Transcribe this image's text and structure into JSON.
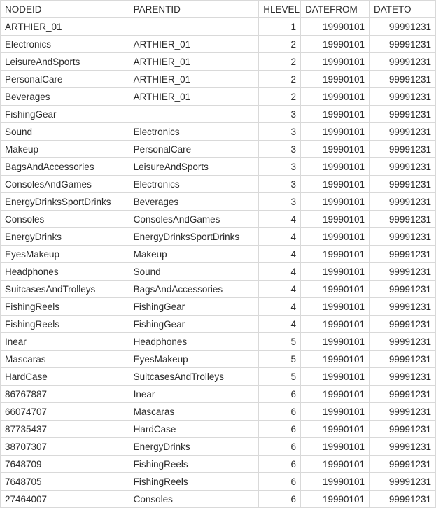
{
  "table": {
    "headers": {
      "nodeid": "NODEID",
      "parentid": "PARENTID",
      "hlevel": "HLEVEL",
      "datefrom": "DATEFROM",
      "dateto": "DATETO"
    },
    "rows": [
      {
        "nodeid": "ARTHIER_01",
        "parentid": "",
        "hlevel": "1",
        "datefrom": "19990101",
        "dateto": "99991231"
      },
      {
        "nodeid": "Electronics",
        "parentid": "ARTHIER_01",
        "hlevel": "2",
        "datefrom": "19990101",
        "dateto": "99991231"
      },
      {
        "nodeid": "LeisureAndSports",
        "parentid": "ARTHIER_01",
        "hlevel": "2",
        "datefrom": "19990101",
        "dateto": "99991231"
      },
      {
        "nodeid": "PersonalCare",
        "parentid": "ARTHIER_01",
        "hlevel": "2",
        "datefrom": "19990101",
        "dateto": "99991231"
      },
      {
        "nodeid": "Beverages",
        "parentid": "ARTHIER_01",
        "hlevel": "2",
        "datefrom": "19990101",
        "dateto": "99991231"
      },
      {
        "nodeid": "FishingGear",
        "parentid": "",
        "hlevel": "3",
        "datefrom": "19990101",
        "dateto": "99991231"
      },
      {
        "nodeid": "Sound",
        "parentid": "Electronics",
        "hlevel": "3",
        "datefrom": "19990101",
        "dateto": "99991231"
      },
      {
        "nodeid": "Makeup",
        "parentid": "PersonalCare",
        "hlevel": "3",
        "datefrom": "19990101",
        "dateto": "99991231"
      },
      {
        "nodeid": "BagsAndAccessories",
        "parentid": "LeisureAndSports",
        "hlevel": "3",
        "datefrom": "19990101",
        "dateto": "99991231"
      },
      {
        "nodeid": "ConsolesAndGames",
        "parentid": "Electronics",
        "hlevel": "3",
        "datefrom": "19990101",
        "dateto": "99991231"
      },
      {
        "nodeid": "EnergyDrinksSportDrinks",
        "parentid": "Beverages",
        "hlevel": "3",
        "datefrom": "19990101",
        "dateto": "99991231"
      },
      {
        "nodeid": "Consoles",
        "parentid": "ConsolesAndGames",
        "hlevel": "4",
        "datefrom": "19990101",
        "dateto": "99991231"
      },
      {
        "nodeid": "EnergyDrinks",
        "parentid": "EnergyDrinksSportDrinks",
        "hlevel": "4",
        "datefrom": "19990101",
        "dateto": "99991231"
      },
      {
        "nodeid": "EyesMakeup",
        "parentid": "Makeup",
        "hlevel": "4",
        "datefrom": "19990101",
        "dateto": "99991231"
      },
      {
        "nodeid": "Headphones",
        "parentid": "Sound",
        "hlevel": "4",
        "datefrom": "19990101",
        "dateto": "99991231"
      },
      {
        "nodeid": "SuitcasesAndTrolleys",
        "parentid": "BagsAndAccessories",
        "hlevel": "4",
        "datefrom": "19990101",
        "dateto": "99991231"
      },
      {
        "nodeid": "FishingReels",
        "parentid": "FishingGear",
        "hlevel": "4",
        "datefrom": "19990101",
        "dateto": "99991231"
      },
      {
        "nodeid": "FishingReels",
        "parentid": "FishingGear",
        "hlevel": "4",
        "datefrom": "19990101",
        "dateto": "99991231"
      },
      {
        "nodeid": "Inear",
        "parentid": "Headphones",
        "hlevel": "5",
        "datefrom": "19990101",
        "dateto": "99991231"
      },
      {
        "nodeid": "Mascaras",
        "parentid": "EyesMakeup",
        "hlevel": "5",
        "datefrom": "19990101",
        "dateto": "99991231"
      },
      {
        "nodeid": "HardCase",
        "parentid": "SuitcasesAndTrolleys",
        "hlevel": "5",
        "datefrom": "19990101",
        "dateto": "99991231"
      },
      {
        "nodeid": "86767887",
        "parentid": "Inear",
        "hlevel": "6",
        "datefrom": "19990101",
        "dateto": "99991231"
      },
      {
        "nodeid": "66074707",
        "parentid": "Mascaras",
        "hlevel": "6",
        "datefrom": "19990101",
        "dateto": "99991231"
      },
      {
        "nodeid": "87735437",
        "parentid": "HardCase",
        "hlevel": "6",
        "datefrom": "19990101",
        "dateto": "99991231"
      },
      {
        "nodeid": "38707307",
        "parentid": "EnergyDrinks",
        "hlevel": "6",
        "datefrom": "19990101",
        "dateto": "99991231"
      },
      {
        "nodeid": "7648709",
        "parentid": "FishingReels",
        "hlevel": "6",
        "datefrom": "19990101",
        "dateto": "99991231"
      },
      {
        "nodeid": "7648705",
        "parentid": "FishingReels",
        "hlevel": "6",
        "datefrom": "19990101",
        "dateto": "99991231"
      },
      {
        "nodeid": "27464007",
        "parentid": "Consoles",
        "hlevel": "6",
        "datefrom": "19990101",
        "dateto": "99991231"
      }
    ]
  }
}
